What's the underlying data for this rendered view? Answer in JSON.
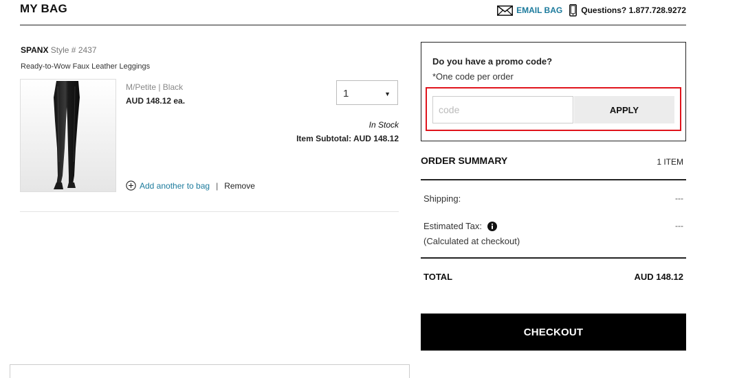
{
  "header": {
    "title": "MY BAG",
    "email_label": "EMAIL BAG",
    "phone_label": "Questions? 1.877.728.9272"
  },
  "item": {
    "brand": "SPANX",
    "style": "Style # 2437",
    "name": "Ready-to-Wow Faux Leather Leggings",
    "variant": "M/Petite | Black",
    "price_each": "AUD 148.12 ea.",
    "quantity": "1",
    "stock_status": "In Stock",
    "subtotal": "Item Subtotal: AUD 148.12",
    "add_another_label": "Add another to bag",
    "separator": "|",
    "remove_label": "Remove",
    "image_icon": "leggings-product-photo"
  },
  "promo": {
    "title": "Do you have a promo code?",
    "note": "*One code per order",
    "placeholder": "code",
    "value": "",
    "apply_label": "APPLY",
    "highlight_color": "#e0131b"
  },
  "summary": {
    "title": "ORDER SUMMARY",
    "item_count": "1 ITEM",
    "shipping_label": "Shipping:",
    "shipping_value": "---",
    "tax_label": "Estimated Tax:",
    "tax_value": "---",
    "tax_note": "(Calculated at checkout)",
    "total_label": "TOTAL",
    "total_value": "AUD 148.12",
    "checkout_label": "CHECKOUT"
  },
  "colors": {
    "link": "#1b7a9c",
    "checkout_bg": "#000000",
    "apply_bg": "#ececec"
  }
}
